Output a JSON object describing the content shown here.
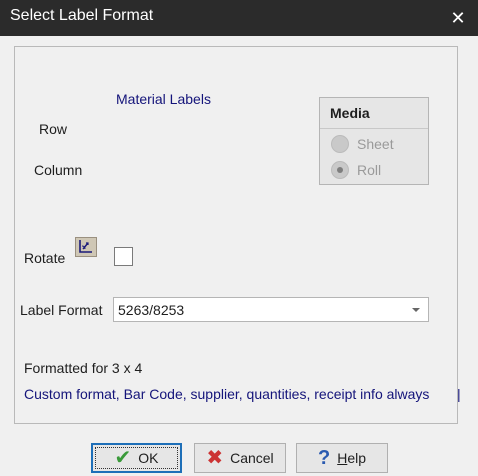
{
  "window": {
    "title": "Select Label Format",
    "close_glyph": "✕"
  },
  "form": {
    "heading": "Material Labels",
    "row_label": "Row",
    "column_label": "Column",
    "rotate_label": "Rotate",
    "rotate_checked": false,
    "label_format_label": "Label Format",
    "label_format_value": "5263/8253",
    "formatted_for": "Formatted for 3 x 4",
    "description": "Custom format, Bar Code, supplier, quantities, receipt info always"
  },
  "media": {
    "title": "Media",
    "options": [
      {
        "label": "Sheet",
        "checked": false,
        "enabled": false
      },
      {
        "label": "Roll",
        "checked": true,
        "enabled": false
      }
    ]
  },
  "buttons": {
    "ok": "OK",
    "cancel": "Cancel",
    "help_hotkey": "H",
    "help_rest": "elp"
  },
  "colors": {
    "title_bar": "#2b2b2b",
    "link_text": "#14147a",
    "ok_icon": "#3a9a3a",
    "cancel_icon": "#cc3333",
    "help_icon": "#2a5ab0"
  },
  "icons": [
    "close-icon",
    "rotate-icon",
    "check-icon",
    "x-icon",
    "help-icon",
    "dropdown-arrow-icon"
  ]
}
